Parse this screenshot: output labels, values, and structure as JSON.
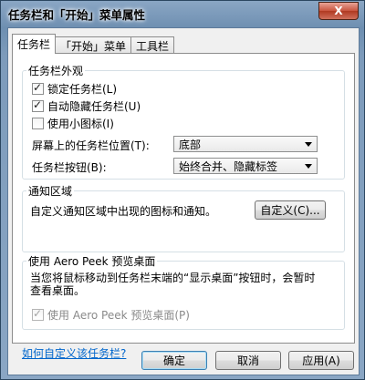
{
  "window": {
    "title": "任务栏和「开始」菜单属性",
    "close_glyph": "X"
  },
  "tabs": [
    {
      "label": "任务栏"
    },
    {
      "label": "「开始」菜单"
    },
    {
      "label": "工具栏"
    }
  ],
  "appearance": {
    "group_title": "任务栏外观",
    "lock_taskbar": {
      "label": "锁定任务栏(L)",
      "checked": true
    },
    "auto_hide": {
      "label": "自动隐藏任务栏(U)",
      "checked": true
    },
    "small_icons": {
      "label": "使用小图标(I)",
      "checked": false
    },
    "location_label": "屏幕上的任务栏位置(T):",
    "location_value": "底部",
    "buttons_label": "任务栏按钮(B):",
    "buttons_value": "始终合并、隐藏标签"
  },
  "notification": {
    "group_title": "通知区域",
    "description": "自定义通知区域中出现的图标和通知。",
    "customize_button": "自定义(C)..."
  },
  "aero_peek": {
    "group_title": "使用 Aero Peek 预览桌面",
    "description_line1": "当您将鼠标移动到任务栏末端的“显示桌面”按钮时，会暂时",
    "description_line2": "查看桌面。",
    "checkbox": {
      "label": "使用 Aero Peek 预览桌面(P)",
      "checked": true,
      "disabled": true
    }
  },
  "help_link": "如何自定义该任务栏?",
  "footer": {
    "ok": "确定",
    "cancel": "取消",
    "apply": "应用(A)"
  }
}
